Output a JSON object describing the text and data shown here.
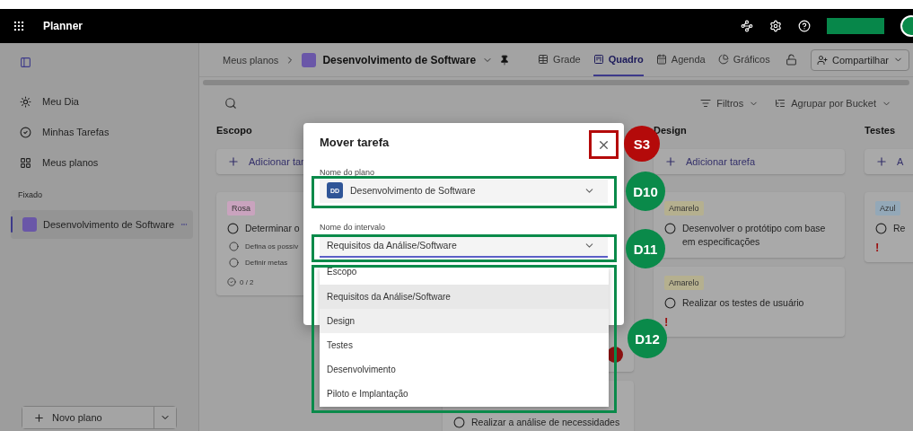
{
  "topbar": {
    "app_name": "Planner"
  },
  "sidebar": {
    "items": [
      {
        "label": "Meu Dia"
      },
      {
        "label": "Minhas Tarefas"
      },
      {
        "label": "Meus planos"
      }
    ],
    "section": "Fixado",
    "pinned": [
      {
        "label": "Desenvolvimento de Software",
        "selected": true
      }
    ],
    "new_plan": "Novo plano"
  },
  "header": {
    "breadcrumb": "Meus planos",
    "plan": "Desenvolvimento de Software",
    "views": [
      {
        "label": "Grade",
        "selected": false
      },
      {
        "label": "Quadro",
        "selected": true
      },
      {
        "label": "Agenda",
        "selected": false
      },
      {
        "label": "Gráficos",
        "selected": false
      }
    ],
    "share": "Compartilhar"
  },
  "toolbar": {
    "filters": "Filtros",
    "group": "Agrupar por Bucket"
  },
  "buckets": [
    {
      "title": "Escopo",
      "add": "Adicionar tar",
      "tasks": [
        {
          "tag": "Rosa",
          "color": "#c9a3be",
          "title": "Determinar o",
          "checklist": [
            "Defina os possív",
            "Definir metas"
          ],
          "progress": "0 / 2"
        }
      ]
    },
    {
      "tasks": [
        {
          "urgent": true
        },
        {
          "title": "Realizar a análise de necessidades"
        }
      ]
    },
    {
      "title": "Design",
      "add": "Adicionar tarefa",
      "tasks": [
        {
          "tag": "Amarelo",
          "color": "#b5b08f",
          "title": "Desenvolver o protótipo com base em especificações"
        },
        {
          "tag": "Amarelo",
          "color": "#b5b08f",
          "title": "Realizar os testes de usuário",
          "priority": "!"
        }
      ]
    },
    {
      "title": "Testes",
      "add": "A",
      "tasks": [
        {
          "tag": "Azul",
          "color": "#93a8b8",
          "title": "Re",
          "priority": "!"
        }
      ]
    }
  ],
  "dialog": {
    "title": "Mover tarefa",
    "plan_label": "Nome do plano",
    "plan_badge": "DD",
    "plan_value": "Desenvolvimento de Software",
    "bucket_label": "Nome do intervalo",
    "bucket_value": "Requisitos da Análise/Software",
    "options": [
      {
        "label": "Escopo",
        "selected": false,
        "hovered": false
      },
      {
        "label": "Requisitos da Análise/Software",
        "selected": true,
        "hovered": false
      },
      {
        "label": "Design",
        "selected": false,
        "hovered": true
      },
      {
        "label": "Testes",
        "selected": false,
        "hovered": false
      },
      {
        "label": "Desenvolvimento",
        "selected": false,
        "hovered": false
      },
      {
        "label": "Piloto e Implantação",
        "selected": false,
        "hovered": false
      }
    ]
  },
  "annotations": [
    {
      "label": "S3",
      "color": "#b40a0a"
    },
    {
      "label": "D10",
      "color": "#0a8a4a"
    },
    {
      "label": "D11",
      "color": "#0a8a4a"
    },
    {
      "label": "D12",
      "color": "#0a8a4a"
    }
  ]
}
